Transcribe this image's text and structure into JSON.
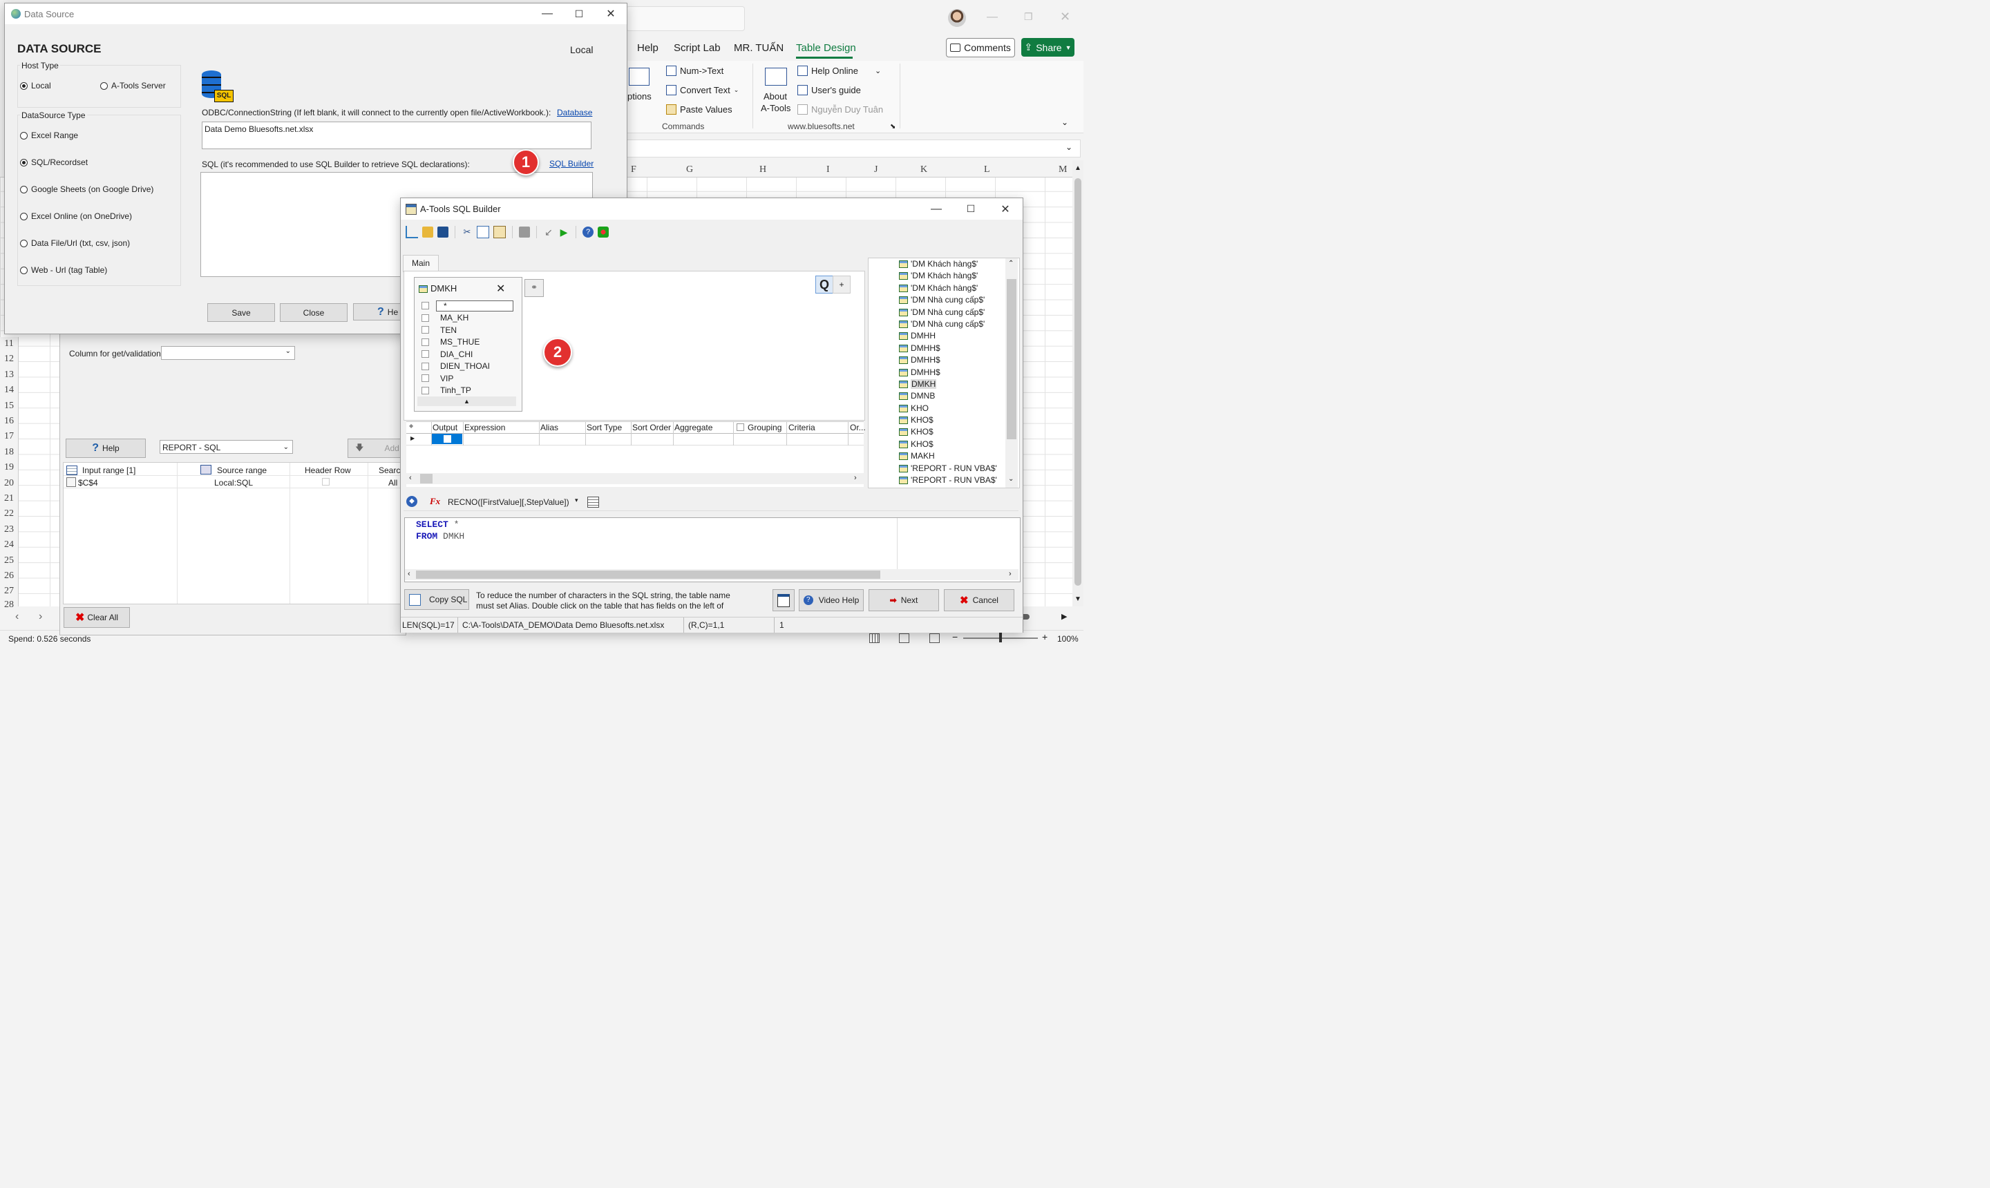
{
  "excel": {
    "menu": [
      "Help",
      "Script Lab",
      "MR. TUẤN",
      "Table Design"
    ],
    "comments_label": "Comments",
    "share_label": "Share",
    "ribbon": {
      "options_label": "ptions",
      "num_text": "Num->Text",
      "convert_text": "Convert Text",
      "paste_values": "Paste Values",
      "commands_group": "Commands",
      "about": "About",
      "atools": "A-Tools",
      "help_online": "Help Online",
      "users_guide": "User's guide",
      "author": "Nguyễn Duy Tuân",
      "website": "www.bluesofts.net"
    },
    "columns": [
      "F",
      "G",
      "H",
      "I",
      "J",
      "K",
      "L",
      "M"
    ],
    "rows": [
      "11",
      "12",
      "13",
      "14",
      "15",
      "16",
      "17",
      "18",
      "19",
      "20",
      "21",
      "22",
      "23",
      "24",
      "25",
      "26",
      "27",
      "28"
    ],
    "status": "Spend: 0.526 seconds",
    "zoom": "100%"
  },
  "back_panel": {
    "column_label": "Column for get/validation",
    "help_label": "Help",
    "report_value": "REPORT - SQL",
    "add_label": "Add",
    "headers": [
      "Input range [1]",
      "Source range",
      "Header Row",
      "Search"
    ],
    "row": {
      "input": "$C$4",
      "source": "Local:SQL",
      "search": "All C"
    },
    "clear_all": "Clear All"
  },
  "data_source": {
    "title": "Data Source",
    "heading": "DATA SOURCE",
    "local_top": "Local",
    "host_type": "Host Type",
    "host_options": [
      "Local",
      "A-Tools Server"
    ],
    "ds_type": "DataSource  Type",
    "ds_options": [
      "Excel Range",
      "SQL/Recordset",
      "Google Sheets (on Google Drive)",
      "Excel Online (on OneDrive)",
      "Data File/Url (txt, csv, json)",
      "Web - Url (tag Table)"
    ],
    "odbc_label": "ODBC/ConnectionString (If left blank, it will connect to the currently open file/ActiveWorkbook.):",
    "database_link": "Database",
    "conn_value": "Data Demo Bluesofts.net.xlsx",
    "sql_label": "SQL (it's recommended to use SQL Builder to retrieve SQL declarations):",
    "sql_builder_link": "SQL Builder",
    "save": "Save",
    "close": "Close",
    "help": "He",
    "db_icon_text": "SQL"
  },
  "markers": [
    "1",
    "2"
  ],
  "sql_builder": {
    "title": "A-Tools SQL Builder",
    "tab_main": "Main",
    "table_name": "DMKH",
    "fields": [
      "*",
      "MA_KH",
      "TEN",
      "MS_THUE",
      "DIA_CHI",
      "DIEN_THOAI",
      "VIP",
      "Tinh_TP"
    ],
    "q_button": "Q",
    "plus_button": "+",
    "grid_headers": [
      "Output",
      "Expression",
      "Alias",
      "Sort Type",
      "Sort Order",
      "Aggregate",
      "Grouping",
      "Criteria",
      "Or..."
    ],
    "tables": [
      "'DM Khách hàng$'",
      "'DM Khách hàng$'",
      "'DM Khách hàng$'",
      "'DM Nhà cung cấp$'",
      "'DM Nhà cung cấp$'",
      "'DM Nhà cung cấp$'",
      "DMHH",
      "DMHH$",
      "DMHH$",
      "DMHH$",
      "DMKH",
      "DMNB",
      "KHO",
      "KHO$",
      "KHO$",
      "KHO$",
      "MAKH",
      "'REPORT - RUN VBA$'",
      "'REPORT - RUN VBA$'"
    ],
    "selected_table": "DMKH",
    "function_value": "RECNO([FirstValue][,StepValue])",
    "sql_kw1": "SELECT",
    "sql_val1": "*",
    "sql_kw2": "FROM",
    "sql_val2": "DMKH",
    "copy_sql": "Copy SQL",
    "hint_line1": "To reduce the number of characters in the SQL string, the table name",
    "hint_line2": "must set Alias. Double click on the table that has fields on the left of",
    "video_help": "Video Help",
    "next": "Next",
    "cancel": "Cancel",
    "status_len": "LEN(SQL)=17",
    "status_path": "C:\\A-Tools\\DATA_DEMO\\Data Demo Bluesofts.net.xlsx",
    "status_rc": "(R,C)=1,1",
    "status_n": "1"
  },
  "colors": {
    "excel_green": "#107c41",
    "marker_red": "#e2302f",
    "link_blue": "#0645ad",
    "selection": "#0078d7"
  }
}
